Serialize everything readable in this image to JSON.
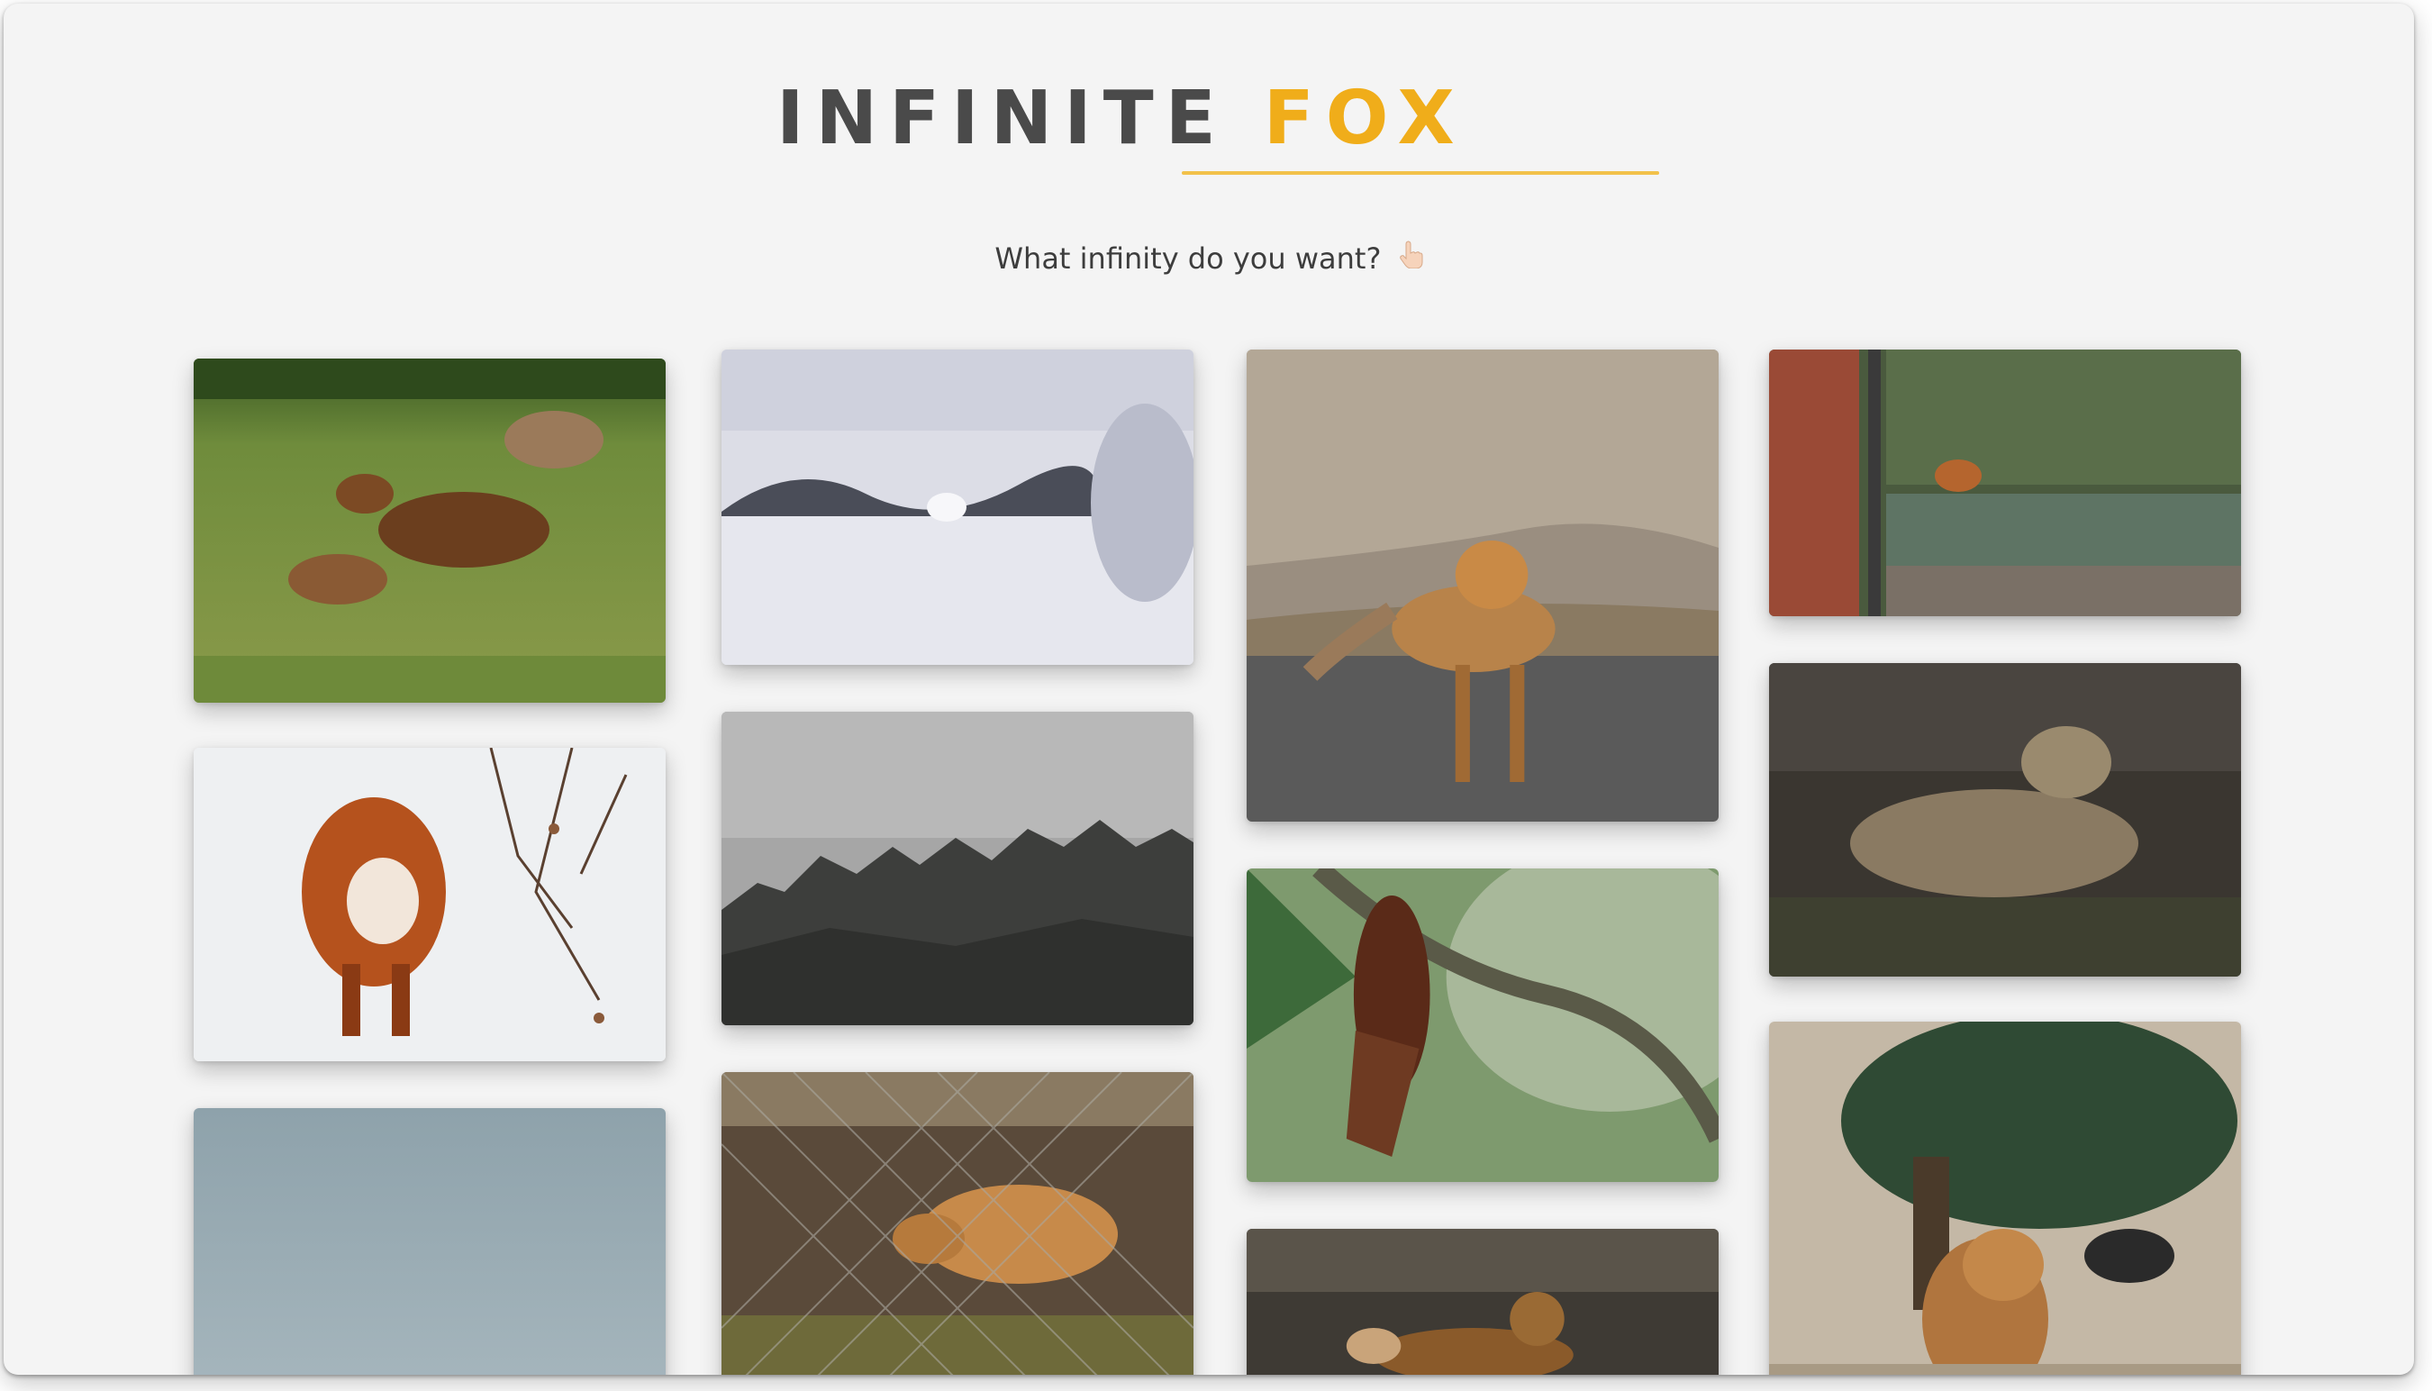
{
  "header": {
    "title_word1": "INFINITE",
    "title_word2": "FOX",
    "accent_color": "#f0ad1a",
    "tagline": "What infinity do you want?",
    "tagline_icon": "pointing-hand-icon"
  },
  "gallery": {
    "columns": 4,
    "photos": [
      {
        "subject": "fox family playing in grass"
      },
      {
        "subject": "arctic fox in snowy field"
      },
      {
        "subject": "red fox standing on rocky road"
      },
      {
        "subject": "fox on shed roof in garden"
      },
      {
        "subject": "red fox in snow"
      },
      {
        "subject": "grey jagged mountain ridge"
      },
      {
        "subject": "hanging fruit bat"
      },
      {
        "subject": "fox in dark undergrowth"
      },
      {
        "subject": "plain grey-blue sky"
      },
      {
        "subject": "fox behind chain-link fence"
      },
      {
        "subject": "dog-like fox in dry brush"
      },
      {
        "subject": "fox sitting under tree"
      }
    ]
  }
}
